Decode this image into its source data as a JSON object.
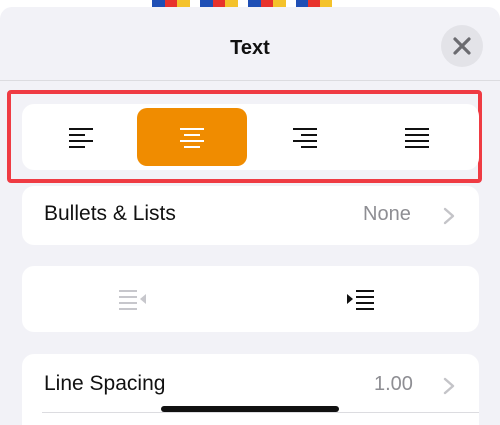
{
  "panel": {
    "title": "Text"
  },
  "alignment": {
    "options": [
      "align-left",
      "align-center",
      "align-right",
      "justify"
    ],
    "selected": "align-center"
  },
  "bullets": {
    "label": "Bullets & Lists",
    "value": "None"
  },
  "line_spacing": {
    "label": "Line Spacing",
    "value": "1.00"
  },
  "colors": {
    "accent": "#f08c00",
    "highlight": "#ef3b43"
  }
}
